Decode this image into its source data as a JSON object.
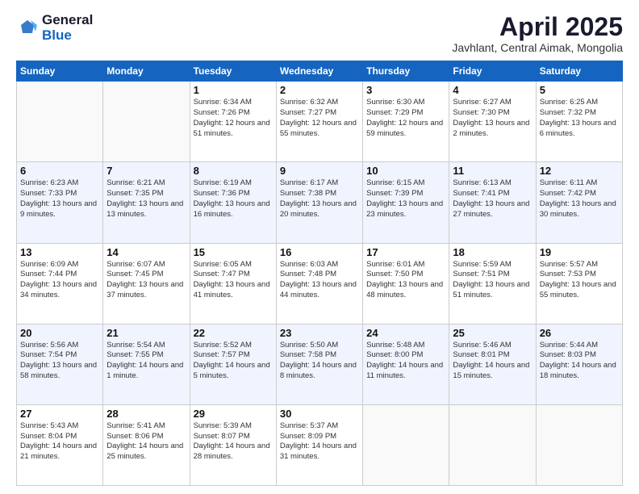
{
  "header": {
    "logo_general": "General",
    "logo_blue": "Blue",
    "month": "April 2025",
    "location": "Javhlant, Central Aimak, Mongolia"
  },
  "weekdays": [
    "Sunday",
    "Monday",
    "Tuesday",
    "Wednesday",
    "Thursday",
    "Friday",
    "Saturday"
  ],
  "weeks": [
    [
      {
        "day": "",
        "info": ""
      },
      {
        "day": "",
        "info": ""
      },
      {
        "day": "1",
        "info": "Sunrise: 6:34 AM\nSunset: 7:26 PM\nDaylight: 12 hours and 51 minutes."
      },
      {
        "day": "2",
        "info": "Sunrise: 6:32 AM\nSunset: 7:27 PM\nDaylight: 12 hours and 55 minutes."
      },
      {
        "day": "3",
        "info": "Sunrise: 6:30 AM\nSunset: 7:29 PM\nDaylight: 12 hours and 59 minutes."
      },
      {
        "day": "4",
        "info": "Sunrise: 6:27 AM\nSunset: 7:30 PM\nDaylight: 13 hours and 2 minutes."
      },
      {
        "day": "5",
        "info": "Sunrise: 6:25 AM\nSunset: 7:32 PM\nDaylight: 13 hours and 6 minutes."
      }
    ],
    [
      {
        "day": "6",
        "info": "Sunrise: 6:23 AM\nSunset: 7:33 PM\nDaylight: 13 hours and 9 minutes."
      },
      {
        "day": "7",
        "info": "Sunrise: 6:21 AM\nSunset: 7:35 PM\nDaylight: 13 hours and 13 minutes."
      },
      {
        "day": "8",
        "info": "Sunrise: 6:19 AM\nSunset: 7:36 PM\nDaylight: 13 hours and 16 minutes."
      },
      {
        "day": "9",
        "info": "Sunrise: 6:17 AM\nSunset: 7:38 PM\nDaylight: 13 hours and 20 minutes."
      },
      {
        "day": "10",
        "info": "Sunrise: 6:15 AM\nSunset: 7:39 PM\nDaylight: 13 hours and 23 minutes."
      },
      {
        "day": "11",
        "info": "Sunrise: 6:13 AM\nSunset: 7:41 PM\nDaylight: 13 hours and 27 minutes."
      },
      {
        "day": "12",
        "info": "Sunrise: 6:11 AM\nSunset: 7:42 PM\nDaylight: 13 hours and 30 minutes."
      }
    ],
    [
      {
        "day": "13",
        "info": "Sunrise: 6:09 AM\nSunset: 7:44 PM\nDaylight: 13 hours and 34 minutes."
      },
      {
        "day": "14",
        "info": "Sunrise: 6:07 AM\nSunset: 7:45 PM\nDaylight: 13 hours and 37 minutes."
      },
      {
        "day": "15",
        "info": "Sunrise: 6:05 AM\nSunset: 7:47 PM\nDaylight: 13 hours and 41 minutes."
      },
      {
        "day": "16",
        "info": "Sunrise: 6:03 AM\nSunset: 7:48 PM\nDaylight: 13 hours and 44 minutes."
      },
      {
        "day": "17",
        "info": "Sunrise: 6:01 AM\nSunset: 7:50 PM\nDaylight: 13 hours and 48 minutes."
      },
      {
        "day": "18",
        "info": "Sunrise: 5:59 AM\nSunset: 7:51 PM\nDaylight: 13 hours and 51 minutes."
      },
      {
        "day": "19",
        "info": "Sunrise: 5:57 AM\nSunset: 7:53 PM\nDaylight: 13 hours and 55 minutes."
      }
    ],
    [
      {
        "day": "20",
        "info": "Sunrise: 5:56 AM\nSunset: 7:54 PM\nDaylight: 13 hours and 58 minutes."
      },
      {
        "day": "21",
        "info": "Sunrise: 5:54 AM\nSunset: 7:55 PM\nDaylight: 14 hours and 1 minute."
      },
      {
        "day": "22",
        "info": "Sunrise: 5:52 AM\nSunset: 7:57 PM\nDaylight: 14 hours and 5 minutes."
      },
      {
        "day": "23",
        "info": "Sunrise: 5:50 AM\nSunset: 7:58 PM\nDaylight: 14 hours and 8 minutes."
      },
      {
        "day": "24",
        "info": "Sunrise: 5:48 AM\nSunset: 8:00 PM\nDaylight: 14 hours and 11 minutes."
      },
      {
        "day": "25",
        "info": "Sunrise: 5:46 AM\nSunset: 8:01 PM\nDaylight: 14 hours and 15 minutes."
      },
      {
        "day": "26",
        "info": "Sunrise: 5:44 AM\nSunset: 8:03 PM\nDaylight: 14 hours and 18 minutes."
      }
    ],
    [
      {
        "day": "27",
        "info": "Sunrise: 5:43 AM\nSunset: 8:04 PM\nDaylight: 14 hours and 21 minutes."
      },
      {
        "day": "28",
        "info": "Sunrise: 5:41 AM\nSunset: 8:06 PM\nDaylight: 14 hours and 25 minutes."
      },
      {
        "day": "29",
        "info": "Sunrise: 5:39 AM\nSunset: 8:07 PM\nDaylight: 14 hours and 28 minutes."
      },
      {
        "day": "30",
        "info": "Sunrise: 5:37 AM\nSunset: 8:09 PM\nDaylight: 14 hours and 31 minutes."
      },
      {
        "day": "",
        "info": ""
      },
      {
        "day": "",
        "info": ""
      },
      {
        "day": "",
        "info": ""
      }
    ]
  ]
}
